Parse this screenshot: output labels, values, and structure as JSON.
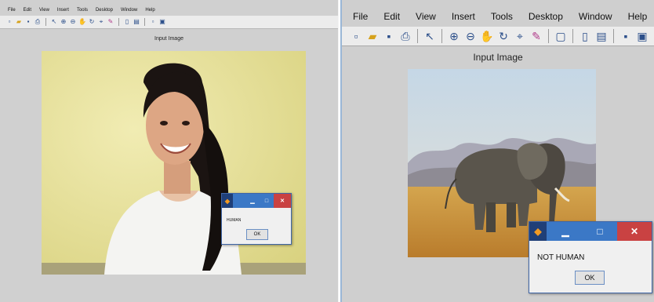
{
  "left_figure": {
    "menu": [
      "File",
      "Edit",
      "View",
      "Insert",
      "Tools",
      "Desktop",
      "Window",
      "Help"
    ],
    "axes_title": "Input Image",
    "dialog": {
      "message": "HUMAN",
      "ok_label": "OK"
    }
  },
  "right_figure": {
    "menu": [
      "File",
      "Edit",
      "View",
      "Insert",
      "Tools",
      "Desktop",
      "Window",
      "Help"
    ],
    "axes_title": "Input Image",
    "dialog": {
      "message": "NOT HUMAN",
      "ok_label": "OK"
    }
  },
  "toolbar_icons": [
    "new-figure-icon",
    "open-file-icon",
    "save-icon",
    "print-icon",
    "edit-plot-pointer-icon",
    "zoom-in-icon",
    "zoom-out-icon",
    "pan-icon",
    "rotate-3d-icon",
    "data-cursor-icon",
    "brush-icon",
    "link-plot-icon",
    "insert-colorbar-icon",
    "insert-legend-icon",
    "hide-plot-tools-icon",
    "show-plot-tools-icon"
  ],
  "colors": {
    "titlebar": "#3b78c6",
    "close_button": "#c94242",
    "figure_background": "#d0d0d0"
  }
}
